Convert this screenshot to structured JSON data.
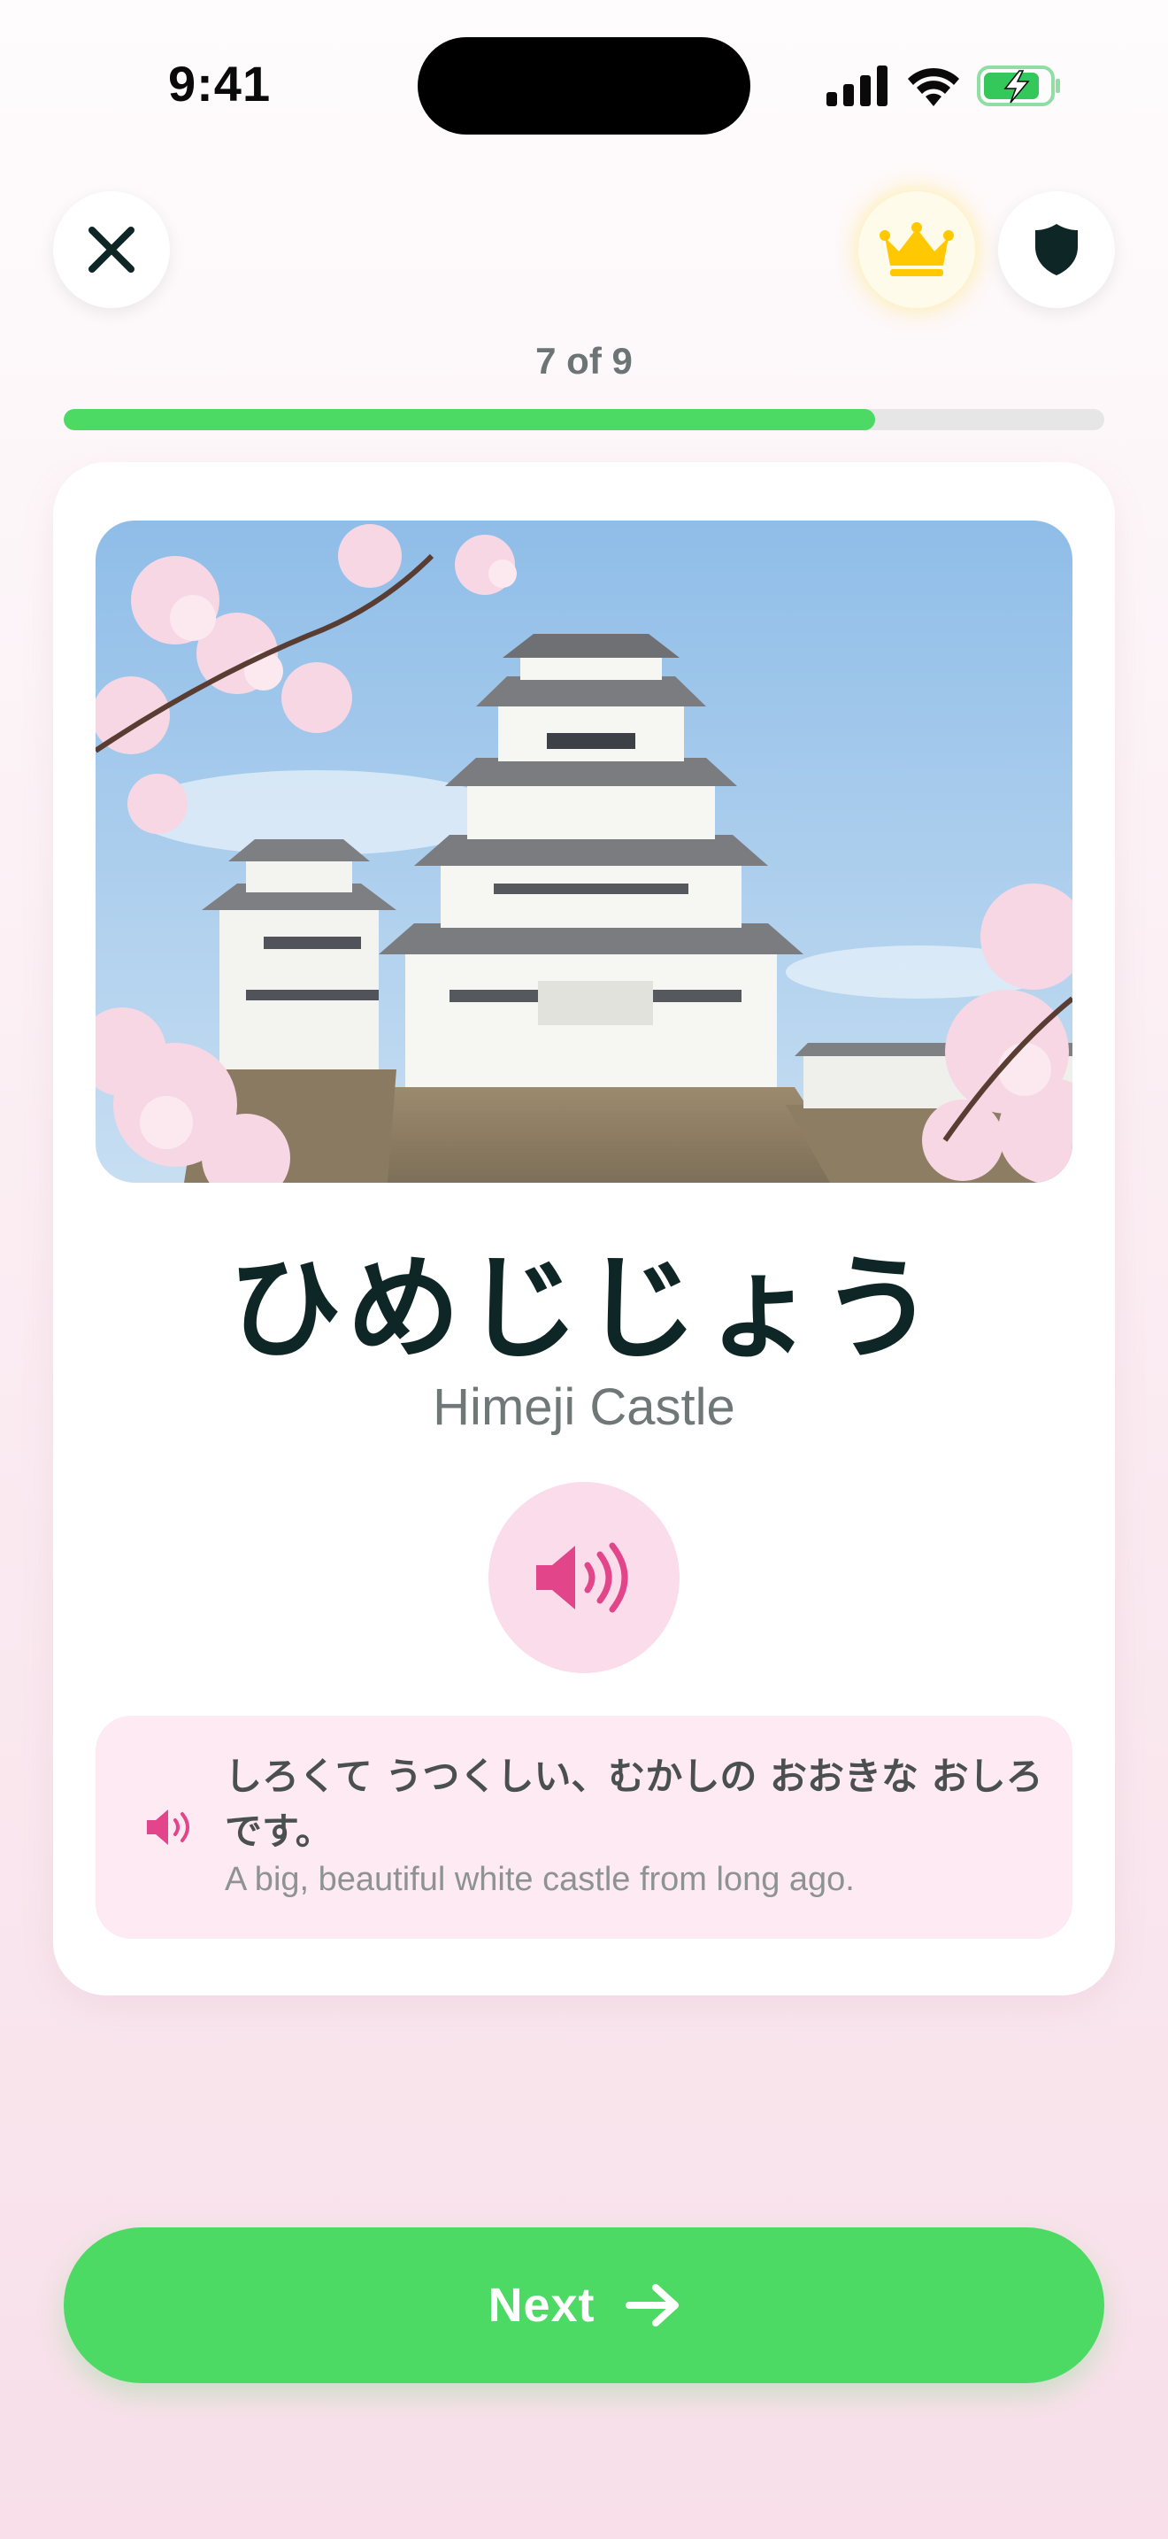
{
  "status_bar": {
    "time": "9:41",
    "icons": [
      "cellular-signal-icon",
      "wifi-icon",
      "battery-charging-icon"
    ]
  },
  "header": {
    "close_icon": "close-icon",
    "premium_icon": "crown-icon",
    "shield_icon": "shield-icon",
    "progress_label": "7 of 9",
    "progress_fraction": 0.78
  },
  "card": {
    "image_alt": "Himeji Castle with cherry blossoms",
    "word": "ひめじじょう",
    "translation": "Himeji Castle",
    "audio_icon": "speaker-icon",
    "example": {
      "japanese": "しろくて うつくしい、むかしの おおきな おしろです。",
      "english": "A big, beautiful white castle from long ago.",
      "icon": "speaker-icon"
    }
  },
  "footer": {
    "next_label": "Next",
    "next_icon": "arrow-right-icon"
  },
  "colors": {
    "accent_green": "#4cd964",
    "accent_pink": "#e2458a",
    "crown_gold": "#ffc800",
    "text_dark": "#0f2626"
  }
}
